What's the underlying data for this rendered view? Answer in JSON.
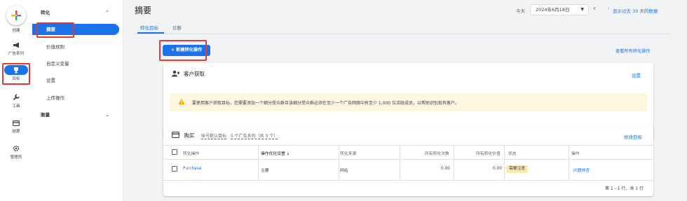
{
  "rail": {
    "create_label": "创建",
    "items": [
      {
        "label": "广告系列",
        "icon": "megaphone-icon"
      },
      {
        "label": "目标",
        "icon": "trophy-icon"
      },
      {
        "label": "工具",
        "icon": "wrench-icon"
      },
      {
        "label": "结算",
        "icon": "credit-card-icon"
      },
      {
        "label": "管理员",
        "icon": "gear-icon"
      }
    ]
  },
  "nav": {
    "section_title": "转化",
    "items": [
      "摘要",
      "价值规则",
      "自定义变量",
      "设置",
      "上传操作"
    ],
    "second_section": "衡量"
  },
  "header": {
    "title": "摘要",
    "today_label": "今天",
    "date_value": "2024年6月18日",
    "show_last": "显示过去 30 天的数据"
  },
  "tabs": [
    "转化目标",
    "诊断"
  ],
  "new_conversion_button": "+ 新建转化操作",
  "view_all_link": "查看所有转化操作",
  "customer_card": {
    "title": "客户获取",
    "settings_link": "设置",
    "warning": "要使用客户获取目标，您需要添加一个细分受众群且该细分受众群必须在至少一个广告网络中有至少 1,000 位活跃成员，以帮助识别现有客户。"
  },
  "purchase_card": {
    "title": "购买",
    "account_default": "账号默认目标",
    "campaigns": "5 个广告系列（共 5 个）",
    "edit_goal": "修改目标",
    "columns": [
      "转化操作",
      "操作优化设置 ↓",
      "转化来源",
      "所有转化次数",
      "所有转化价值",
      "状态",
      "操作"
    ],
    "rows": [
      {
        "action": "Purchase",
        "optimization": "主要",
        "source": "网站",
        "all_conversions": "0.00",
        "all_value": "0.00",
        "status": "需要注意",
        "operation": "问题排查"
      }
    ],
    "pager": "第 1 - 1 行，共 1 行"
  },
  "colors": {
    "accent": "#1a73e8",
    "highlight": "#e53935",
    "warning_bg": "#fef7e0"
  }
}
